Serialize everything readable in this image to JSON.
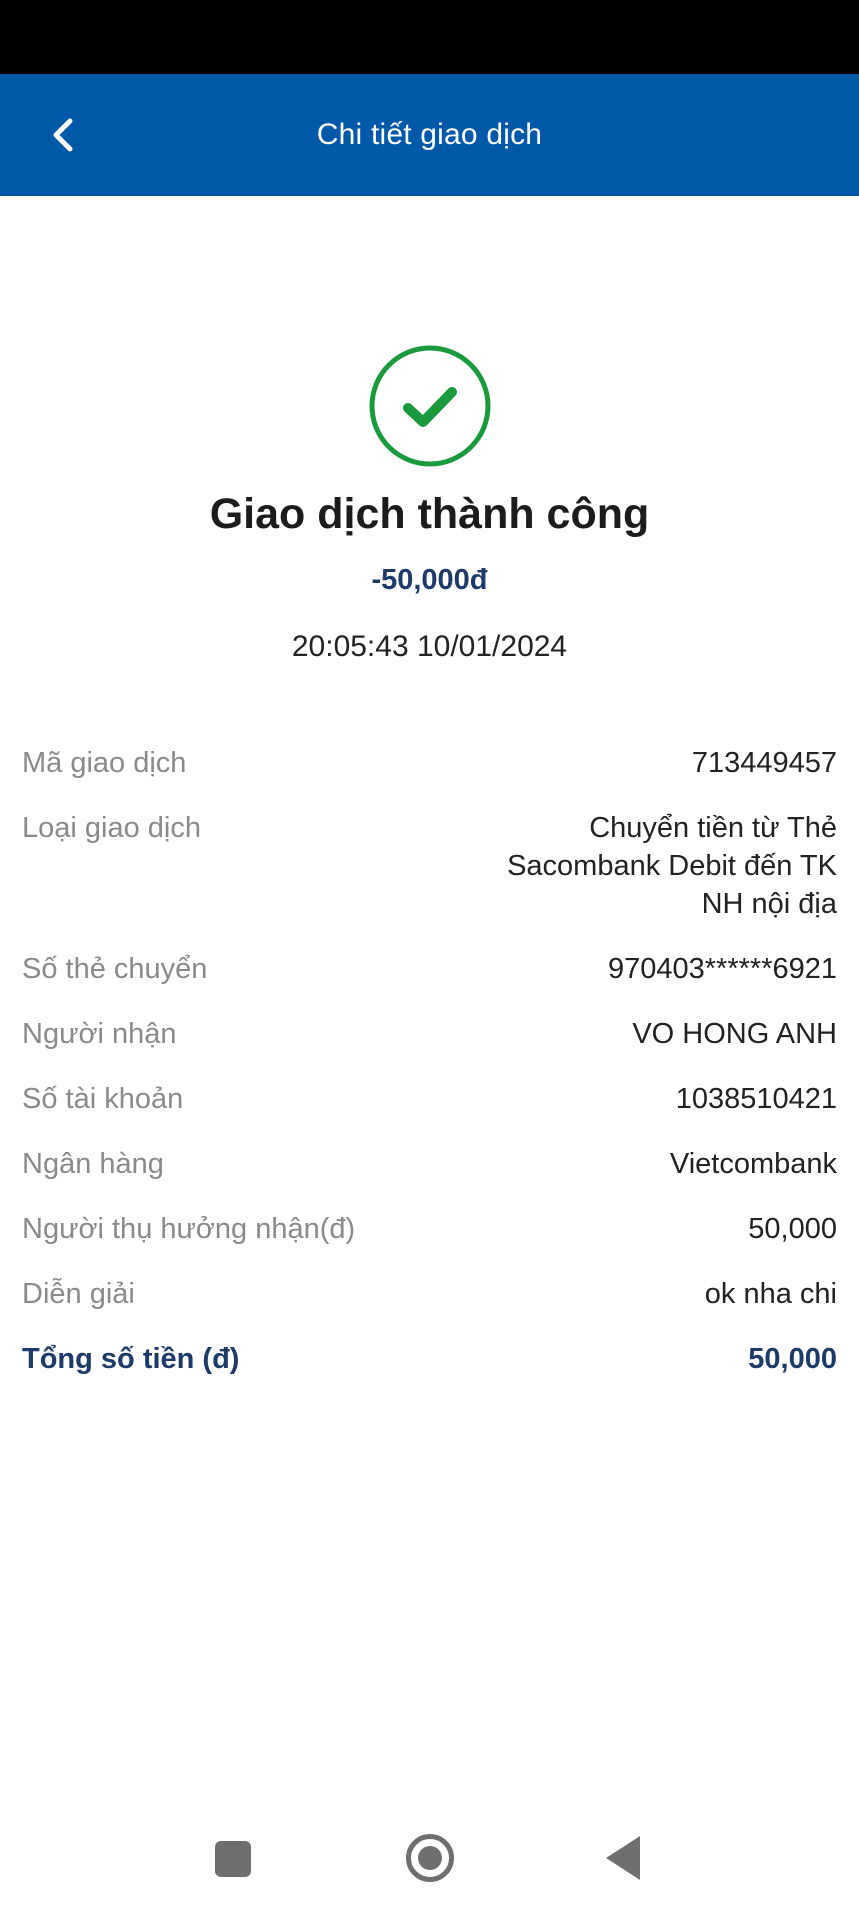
{
  "header": {
    "title": "Chi tiết giao dịch",
    "back_icon": "chevron-left-icon"
  },
  "result": {
    "icon": "check-circle-icon",
    "icon_color": "#1a9a3c",
    "title": "Giao dịch thành công",
    "amount": "-50,000đ",
    "datetime": "20:05:43 10/01/2024"
  },
  "details": [
    {
      "label": "Mã giao dịch",
      "value": "713449457"
    },
    {
      "label": "Loại giao dịch",
      "value": "Chuyển tiền từ Thẻ\nSacombank Debit đến TK\nNH nội địa"
    },
    {
      "label": "Số thẻ chuyển",
      "value": "970403******6921"
    },
    {
      "label": "Người nhận",
      "value": "VO HONG ANH"
    },
    {
      "label": "Số tài khoản",
      "value": "1038510421"
    },
    {
      "label": "Ngân hàng",
      "value": "Vietcombank"
    },
    {
      "label": "Người thụ hưởng nhận(đ)",
      "value": "50,000"
    },
    {
      "label": "Diễn giải",
      "value": "ok nha chi"
    }
  ],
  "total": {
    "label": "Tổng số tiền (đ)",
    "value": "50,000"
  },
  "colors": {
    "header_bg": "#0059a8",
    "accent_text": "#1d3a68",
    "success": "#1a9a3c"
  },
  "system_nav": {
    "icons": [
      "recents-square-icon",
      "home-circle-icon",
      "back-triangle-icon"
    ]
  }
}
